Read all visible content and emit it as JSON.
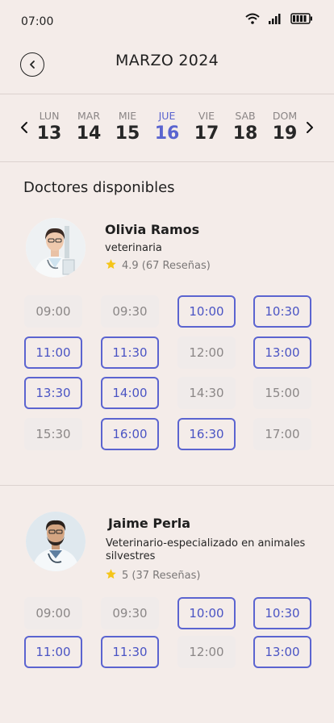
{
  "status": {
    "time": "07:00",
    "icons": [
      "wifi-icon",
      "signal-icon",
      "battery-icon"
    ]
  },
  "header": {
    "title": "MARZO 2024",
    "back_icon": "chevron-left-icon"
  },
  "week": {
    "days": [
      {
        "label": "LUN",
        "number": "13",
        "active": false
      },
      {
        "label": "MAR",
        "number": "14",
        "active": false
      },
      {
        "label": "MIE",
        "number": "15",
        "active": false
      },
      {
        "label": "JUE",
        "number": "16",
        "active": true
      },
      {
        "label": "VIE",
        "number": "17",
        "active": false
      },
      {
        "label": "SAB",
        "number": "18",
        "active": false
      },
      {
        "label": "DOM",
        "number": "19",
        "active": false
      }
    ],
    "active_color": "#5a64cf"
  },
  "section_title": "Doctores disponibles",
  "doctors": [
    {
      "name": "Olivia Ramos",
      "role": "veterinaria",
      "rating": "4.9 (67 Reseñas)",
      "slots": [
        {
          "time": "09:00",
          "available": false
        },
        {
          "time": "09:30",
          "available": false
        },
        {
          "time": "10:00",
          "available": true
        },
        {
          "time": "10:30",
          "available": true
        },
        {
          "time": "11:00",
          "available": true
        },
        {
          "time": "11:30",
          "available": true
        },
        {
          "time": "12:00",
          "available": false
        },
        {
          "time": "13:00",
          "available": true
        },
        {
          "time": "13:30",
          "available": true
        },
        {
          "time": "14:00",
          "available": true
        },
        {
          "time": "14:30",
          "available": false
        },
        {
          "time": "15:00",
          "available": false
        },
        {
          "time": "15:30",
          "available": false
        },
        {
          "time": "16:00",
          "available": true
        },
        {
          "time": "16:30",
          "available": true
        },
        {
          "time": "17:00",
          "available": false
        }
      ]
    },
    {
      "name": "Jaime Perla",
      "role_line1": "Veterinario-especializado en animales",
      "role_line2": "silvestres",
      "rating": "5 (37 Reseñas)",
      "slots": [
        {
          "time": "09:00",
          "available": false
        },
        {
          "time": "09:30",
          "available": false
        },
        {
          "time": "10:00",
          "available": true
        },
        {
          "time": "10:30",
          "available": true
        },
        {
          "time": "11:00",
          "available": true
        },
        {
          "time": "11:30",
          "available": true
        },
        {
          "time": "12:00",
          "available": false
        },
        {
          "time": "13:00",
          "available": true
        }
      ]
    }
  ],
  "colors": {
    "background": "#f4ece9",
    "accent": "#5b64d0",
    "star": "#f5c518"
  }
}
